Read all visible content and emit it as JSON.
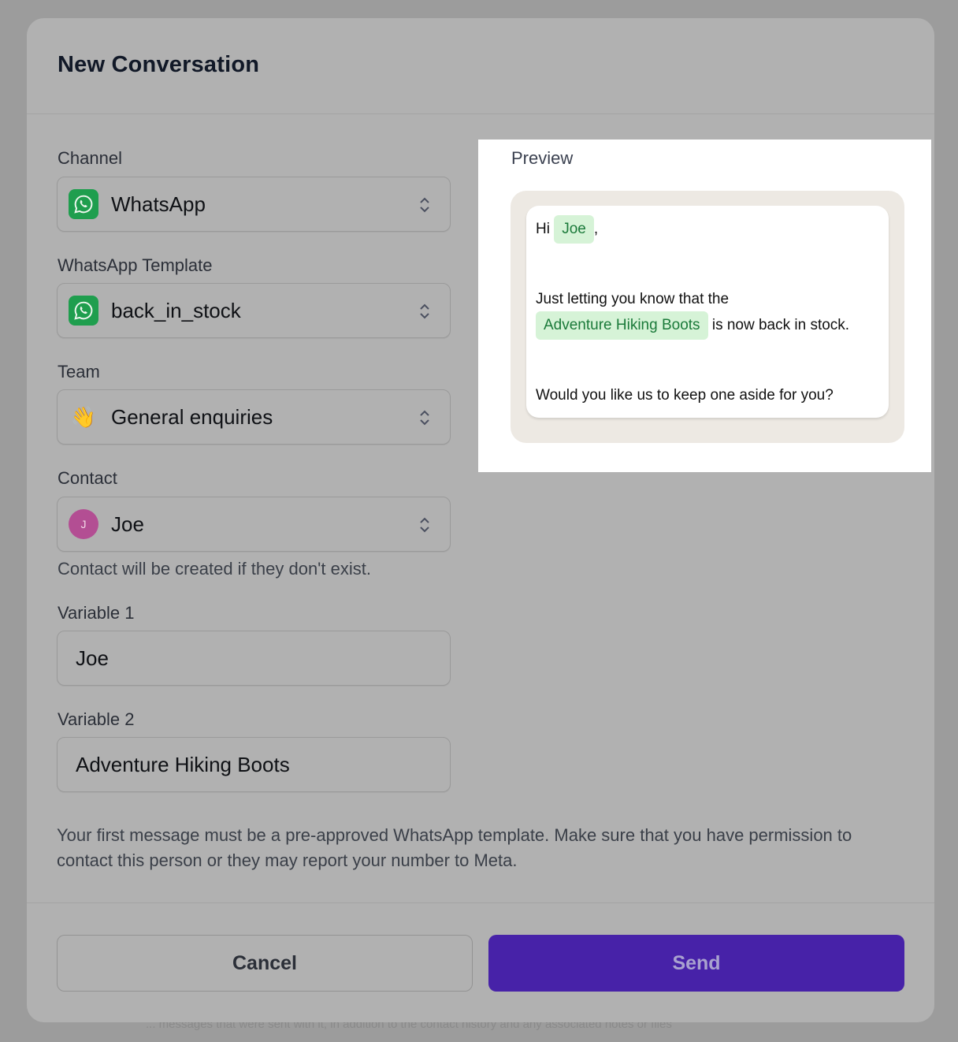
{
  "modal": {
    "title": "New Conversation"
  },
  "form": {
    "channel": {
      "label": "Channel",
      "value": "WhatsApp",
      "icon": "whatsapp-icon"
    },
    "template": {
      "label": "WhatsApp Template",
      "value": "back_in_stock",
      "icon": "whatsapp-icon"
    },
    "team": {
      "label": "Team",
      "value": "General enquiries",
      "icon": "waving-hand-emoji",
      "emoji": "👋"
    },
    "contact": {
      "label": "Contact",
      "value": "Joe",
      "avatar_initial": "J",
      "hint": "Contact will be created if they don't exist."
    },
    "variable1": {
      "label": "Variable 1",
      "value": "Joe"
    },
    "variable2": {
      "label": "Variable 2",
      "value": "Adventure Hiking Boots"
    }
  },
  "notice": "Your first message must be a pre-approved WhatsApp template. Make sure that you have permission to contact this person or they may report your number to Meta.",
  "buttons": {
    "cancel": "Cancel",
    "send": "Send"
  },
  "preview": {
    "label": "Preview",
    "greeting_prefix": "Hi",
    "greeting_var": "Joe",
    "greeting_suffix": ",",
    "line2_prefix": "Just letting you know that the",
    "line2_var": "Adventure Hiking Boots",
    "line2_suffix": "is now back in stock.",
    "line3": "Would you like us to keep one aside for you?"
  },
  "background": {
    "partial_text": "... messages that were sent with it, in addition to the contact history and any associated notes or files"
  },
  "colors": {
    "send_button": "#4722a8",
    "whatsapp_green": "#1f9e4e",
    "variable_chip_bg": "#d6f3d7",
    "variable_chip_text": "#1b7a3a",
    "avatar_bg": "#b34e93"
  }
}
